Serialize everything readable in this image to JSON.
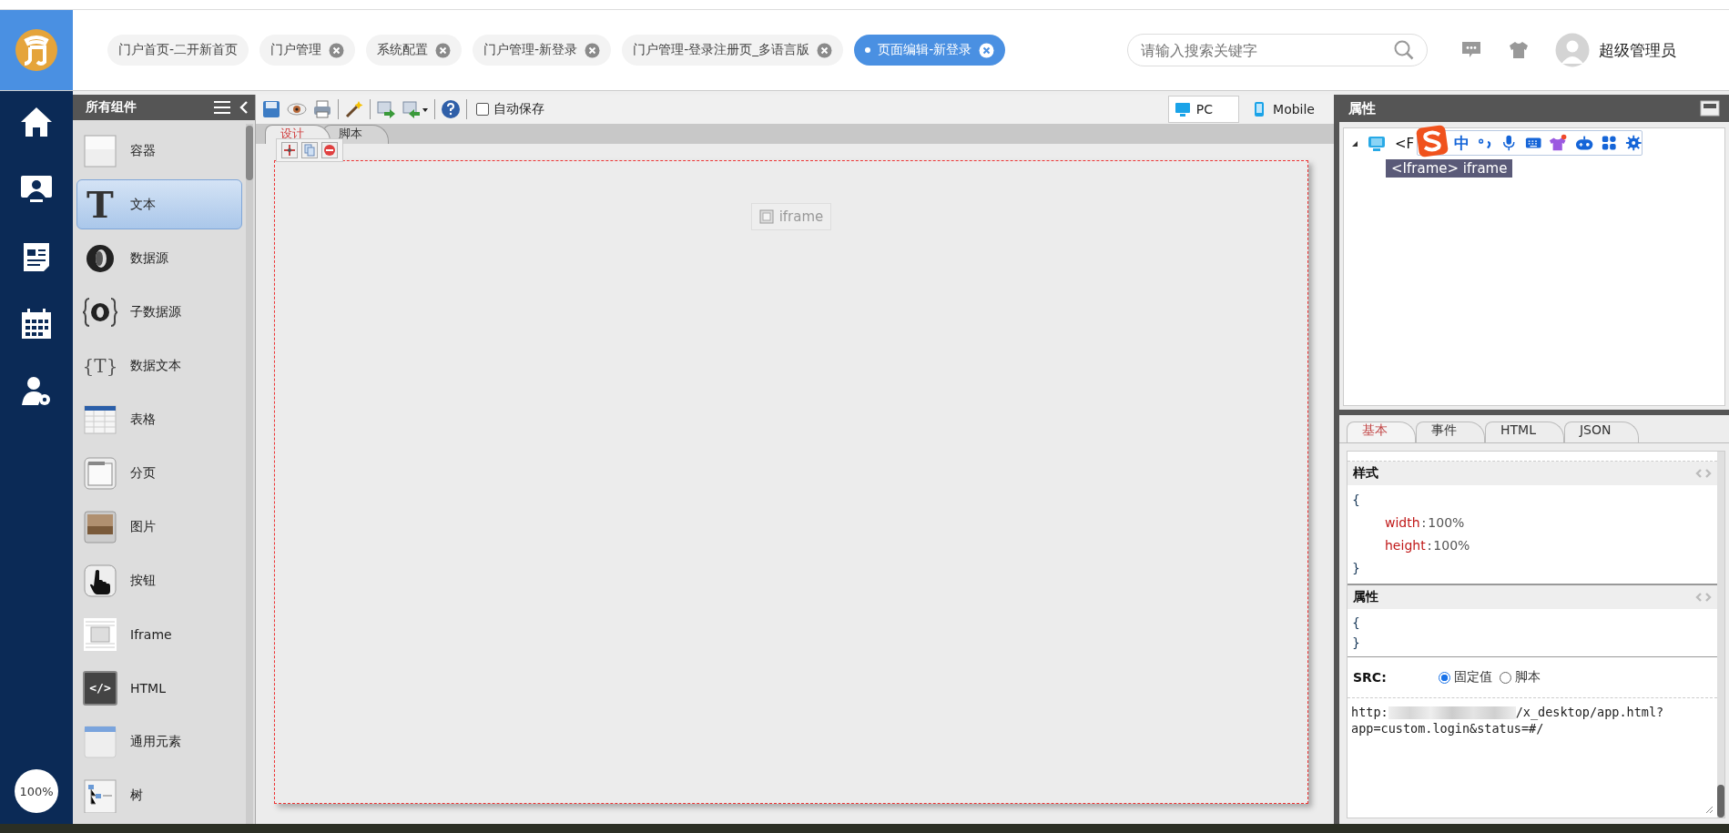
{
  "header": {
    "tabs": [
      {
        "label": "门户首页-二开新首页",
        "closable": false,
        "selected": false
      },
      {
        "label": "门户管理",
        "closable": true,
        "selected": false
      },
      {
        "label": "系统配置",
        "closable": true,
        "selected": false
      },
      {
        "label": "门户管理-新登录",
        "closable": true,
        "selected": false
      },
      {
        "label": "门户管理-登录注册页_多语言版",
        "closable": true,
        "selected": false
      },
      {
        "label": "页面编辑-新登录",
        "closable": true,
        "selected": true
      }
    ],
    "search": {
      "placeholder": "请输入搜索关键字"
    },
    "user": "超级管理员"
  },
  "zoom": "100%",
  "components": {
    "title": "所有组件",
    "items": [
      {
        "label": "容器",
        "kind": "container",
        "selected": false
      },
      {
        "label": "文本",
        "kind": "text",
        "glyph": "T",
        "selected": true
      },
      {
        "label": "数据源",
        "kind": "datasource",
        "selected": false
      },
      {
        "label": "子数据源",
        "kind": "subsource",
        "selected": false
      },
      {
        "label": "数据文本",
        "kind": "datatext",
        "glyph": "{T}",
        "selected": false
      },
      {
        "label": "表格",
        "kind": "table",
        "selected": false
      },
      {
        "label": "分页",
        "kind": "tabs",
        "selected": false
      },
      {
        "label": "图片",
        "kind": "image",
        "selected": false
      },
      {
        "label": "按钮",
        "kind": "button",
        "selected": false
      },
      {
        "label": "Iframe",
        "kind": "iframe",
        "selected": false
      },
      {
        "label": "HTML",
        "kind": "html",
        "glyph": "</>",
        "selected": false
      },
      {
        "label": "通用元素",
        "kind": "element",
        "selected": false
      },
      {
        "label": "树",
        "kind": "tree",
        "selected": false
      }
    ]
  },
  "toolbar": {
    "autosave": {
      "label": "自动保存",
      "checked": false
    },
    "devices": [
      {
        "label": "PC",
        "kind": "pc",
        "selected": true
      },
      {
        "label": "Mobile",
        "kind": "mobile",
        "selected": false
      }
    ]
  },
  "editor_tabs": [
    {
      "label": "设计",
      "selected": true
    },
    {
      "label": "脚本",
      "selected": false
    }
  ],
  "canvas": {
    "element": "iframe"
  },
  "properties": {
    "title": "属性",
    "tree": {
      "root": "<F",
      "child": "<Iframe> iframe"
    },
    "ime": {
      "mode": "中"
    },
    "tabs": [
      {
        "label": "基本",
        "selected": true
      },
      {
        "label": "事件",
        "selected": false
      },
      {
        "label": "HTML",
        "selected": false
      },
      {
        "label": "JSON",
        "selected": false
      }
    ],
    "style": {
      "title": "样式",
      "open": "{",
      "close": "}",
      "rules": [
        {
          "prop": "width",
          "sep": ":",
          "value": "100%"
        },
        {
          "prop": "height",
          "sep": ":",
          "value": "100%"
        }
      ]
    },
    "attributes": {
      "title": "属性",
      "open": "{",
      "close": "}"
    },
    "src": {
      "label": "SRC:",
      "options": [
        {
          "label": "固定值",
          "selected": true
        },
        {
          "label": "脚本",
          "selected": false
        }
      ],
      "url_start": "http:",
      "url_end": "/x_desktop/app.html?",
      "url_line2": "app=custom.login&status=#/"
    }
  }
}
